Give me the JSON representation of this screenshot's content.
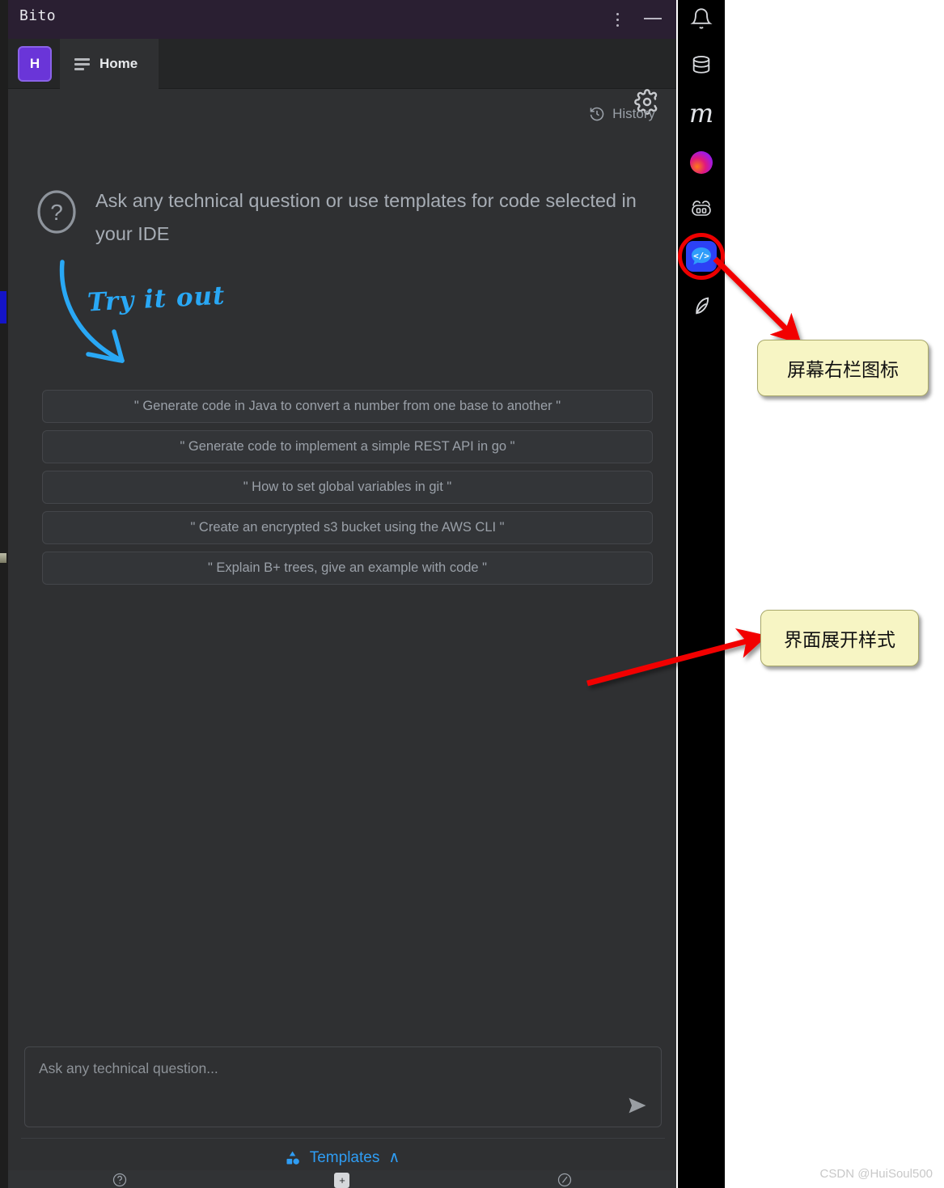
{
  "window": {
    "app_title": "Bito",
    "menu_icon": "kebab-menu-icon",
    "minimize_icon": "minimize-icon"
  },
  "tabstrip": {
    "account_badge": "H",
    "tab_label": "Home",
    "settings_icon": "gear-icon"
  },
  "toolbar": {
    "history_label": "History",
    "history_icon": "history-clock-icon"
  },
  "intro": {
    "icon": "question-mark-circle-icon",
    "text": "Ask any technical question or use templates for code selected in your IDE",
    "annotation_text": "Try it out",
    "annotation_arrow": "curved-down-arrow"
  },
  "suggestions": [
    "\" Generate code in Java to convert a number from one base to another \"",
    "\" Generate code to implement a simple REST API in go \"",
    "\" How to set global variables in git \"",
    "\" Create an encrypted s3 bucket using the AWS CLI \"",
    "\" Explain B+ trees, give an example with code \""
  ],
  "composer": {
    "placeholder": "Ask any technical question...",
    "value": "",
    "send_icon": "send-paper-plane-icon"
  },
  "templates": {
    "label": "Templates",
    "icon": "shapes-icon",
    "caret": "∧"
  },
  "footer": {
    "items": [
      {
        "name": "help",
        "icon": "question-circle-icon",
        "label": ""
      },
      {
        "name": "add",
        "icon": "plus-icon",
        "label": "+"
      },
      {
        "name": "feedback",
        "icon": "pen-circle-icon",
        "label": ""
      }
    ]
  },
  "activity_bar": {
    "items": [
      {
        "name": "notifications",
        "icon": "bell-icon",
        "active": false
      },
      {
        "name": "database",
        "icon": "database-icon",
        "active": false
      },
      {
        "name": "mongodb",
        "icon": "letter-m-icon",
        "active": false
      },
      {
        "name": "gradient-tool",
        "icon": "gradient-orb-icon",
        "active": false
      },
      {
        "name": "copilot",
        "icon": "robot-face-icon",
        "active": false
      },
      {
        "name": "bito",
        "icon": "bito-code-chat-icon",
        "active": true
      },
      {
        "name": "leaf-tool",
        "icon": "leaf-icon",
        "active": false
      }
    ]
  },
  "annotations": [
    {
      "id": "anno1",
      "text": "屏幕右栏图标"
    },
    {
      "id": "anno2",
      "text": "界面展开样式"
    }
  ],
  "watermark": "CSDN @HuiSoul500",
  "colors": {
    "titlebar": "#2a1f32",
    "panel": "#2f3032",
    "accent_blue": "#2f9df4",
    "badge_purple": "#6a35d8",
    "highlight_red": "#ee0000",
    "note_yellow": "#f7f5c4"
  }
}
